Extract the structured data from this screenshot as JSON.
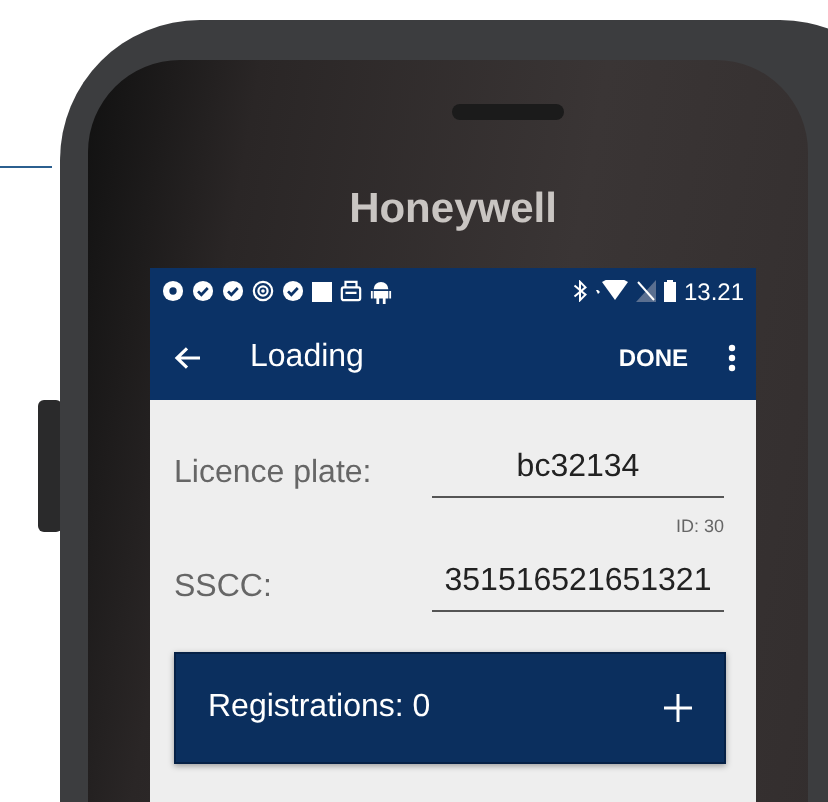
{
  "device": {
    "label": "Honeywell"
  },
  "status_bar": {
    "time": "13.21"
  },
  "app_bar": {
    "title": "Loading",
    "action": "DONE"
  },
  "fields": [
    {
      "label": "Licence plate:",
      "value": "bc32134",
      "note": "ID: 30"
    },
    {
      "label": "SSCC:",
      "value": "351516521651321"
    }
  ],
  "registrations": {
    "label": "Registrations: 0"
  }
}
